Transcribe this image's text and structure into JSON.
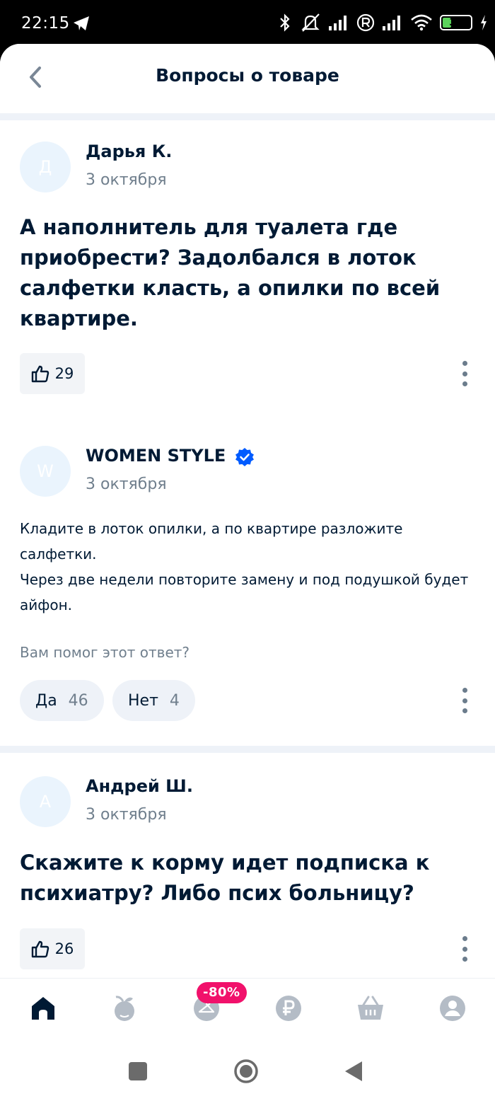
{
  "status_bar": {
    "time": "22:15",
    "battery": "30",
    "icons": [
      "telegram-icon",
      "bluetooth-icon",
      "mute-icon",
      "signal-icon",
      "registered-icon",
      "wifi-icon",
      "battery-icon",
      "charging-icon"
    ]
  },
  "header": {
    "title": "Вопросы о товаре",
    "back_icon": "chevron-left-icon"
  },
  "posts": [
    {
      "avatar_letter": "Д",
      "author": "Дарья К.",
      "date": "3 октября",
      "question": "А наполнитель для туалета где приобрести? Задолбался в лоток салфетки класть, а опилки по всей квартире.",
      "likes": "29"
    },
    {
      "avatar_letter": "W",
      "author": "WOMEN STYLE",
      "verified": true,
      "date": "3 октября",
      "answer_line1": "Кладите в лоток опилки, а по квартире разложите салфетки.",
      "answer_line2": "Через две недели повторите замену и под подушкой будет айфон.",
      "helpful_prompt": "Вам помог этот ответ?",
      "yes_label": "Да",
      "yes_count": "46",
      "no_label": "Нет",
      "no_count": "4"
    },
    {
      "avatar_letter": "А",
      "author": "Андрей Ш.",
      "date": "3 октября",
      "question": "Скажите к корму идет подписка к психиатру? Либо псих больницу?",
      "likes": "26"
    }
  ],
  "tabbar": {
    "items": [
      "home-icon",
      "fruit-icon",
      "hanger-icon",
      "ruble-icon",
      "basket-icon",
      "profile-icon"
    ],
    "badge": "-80%"
  },
  "colors": {
    "accent": "#005bff",
    "badge": "#f1116b",
    "text": "#001a34",
    "muted": "#707f8d",
    "icon": "#b4bcc6"
  }
}
